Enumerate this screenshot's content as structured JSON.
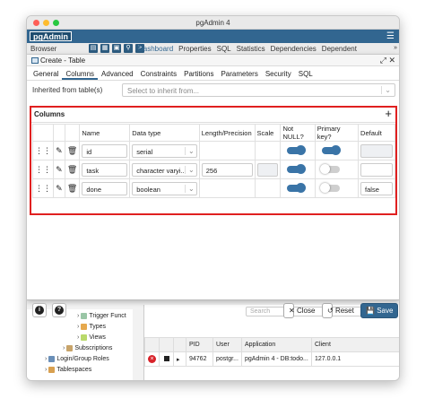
{
  "window": {
    "title": "pgAdmin 4"
  },
  "app": {
    "logo": "pgAdmin",
    "menu_icon": "hamburger-icon"
  },
  "toolbar": {
    "browser_label": "Browser",
    "tabs": [
      "Dashboard",
      "Properties",
      "SQL",
      "Statistics",
      "Dependencies",
      "Dependent"
    ],
    "extra": "»"
  },
  "dialog": {
    "title": "Create - Table",
    "tabs": [
      "General",
      "Columns",
      "Advanced",
      "Constraints",
      "Partitions",
      "Parameters",
      "Security",
      "SQL"
    ],
    "active_tab": "Columns",
    "inherit": {
      "label": "Inherited from table(s)",
      "placeholder": "Select to inherit from..."
    },
    "columns": {
      "label": "Columns",
      "headers": [
        "Name",
        "Data type",
        "Length/Precision",
        "Scale",
        "Not NULL?",
        "Primary key?",
        "Default"
      ],
      "rows": [
        {
          "name": "id",
          "type": "serial",
          "length": "",
          "scale": "",
          "not_null": true,
          "primary_key": true,
          "default": ""
        },
        {
          "name": "task",
          "type": "character varyi...",
          "length": "256",
          "scale": "",
          "not_null": true,
          "primary_key": false,
          "default": ""
        },
        {
          "name": "done",
          "type": "boolean",
          "length": "",
          "scale": "",
          "not_null": true,
          "primary_key": false,
          "default": "false"
        }
      ]
    },
    "footer": {
      "close": "Close",
      "reset": "Reset",
      "save": "Save",
      "info": "i",
      "help": "?"
    }
  },
  "background": {
    "tree": [
      "Trigger Funct",
      "Types",
      "Views",
      "Subscriptions",
      "Login/Group Roles",
      "Tablespaces"
    ],
    "search_placeholder": "Search",
    "activity": {
      "headers": [
        "",
        "",
        "",
        "PID",
        "User",
        "Application",
        "Client"
      ],
      "row": [
        "94762",
        "postgr...",
        "pgAdmin 4 - DB:todo...",
        "127.0.0.1"
      ]
    }
  }
}
